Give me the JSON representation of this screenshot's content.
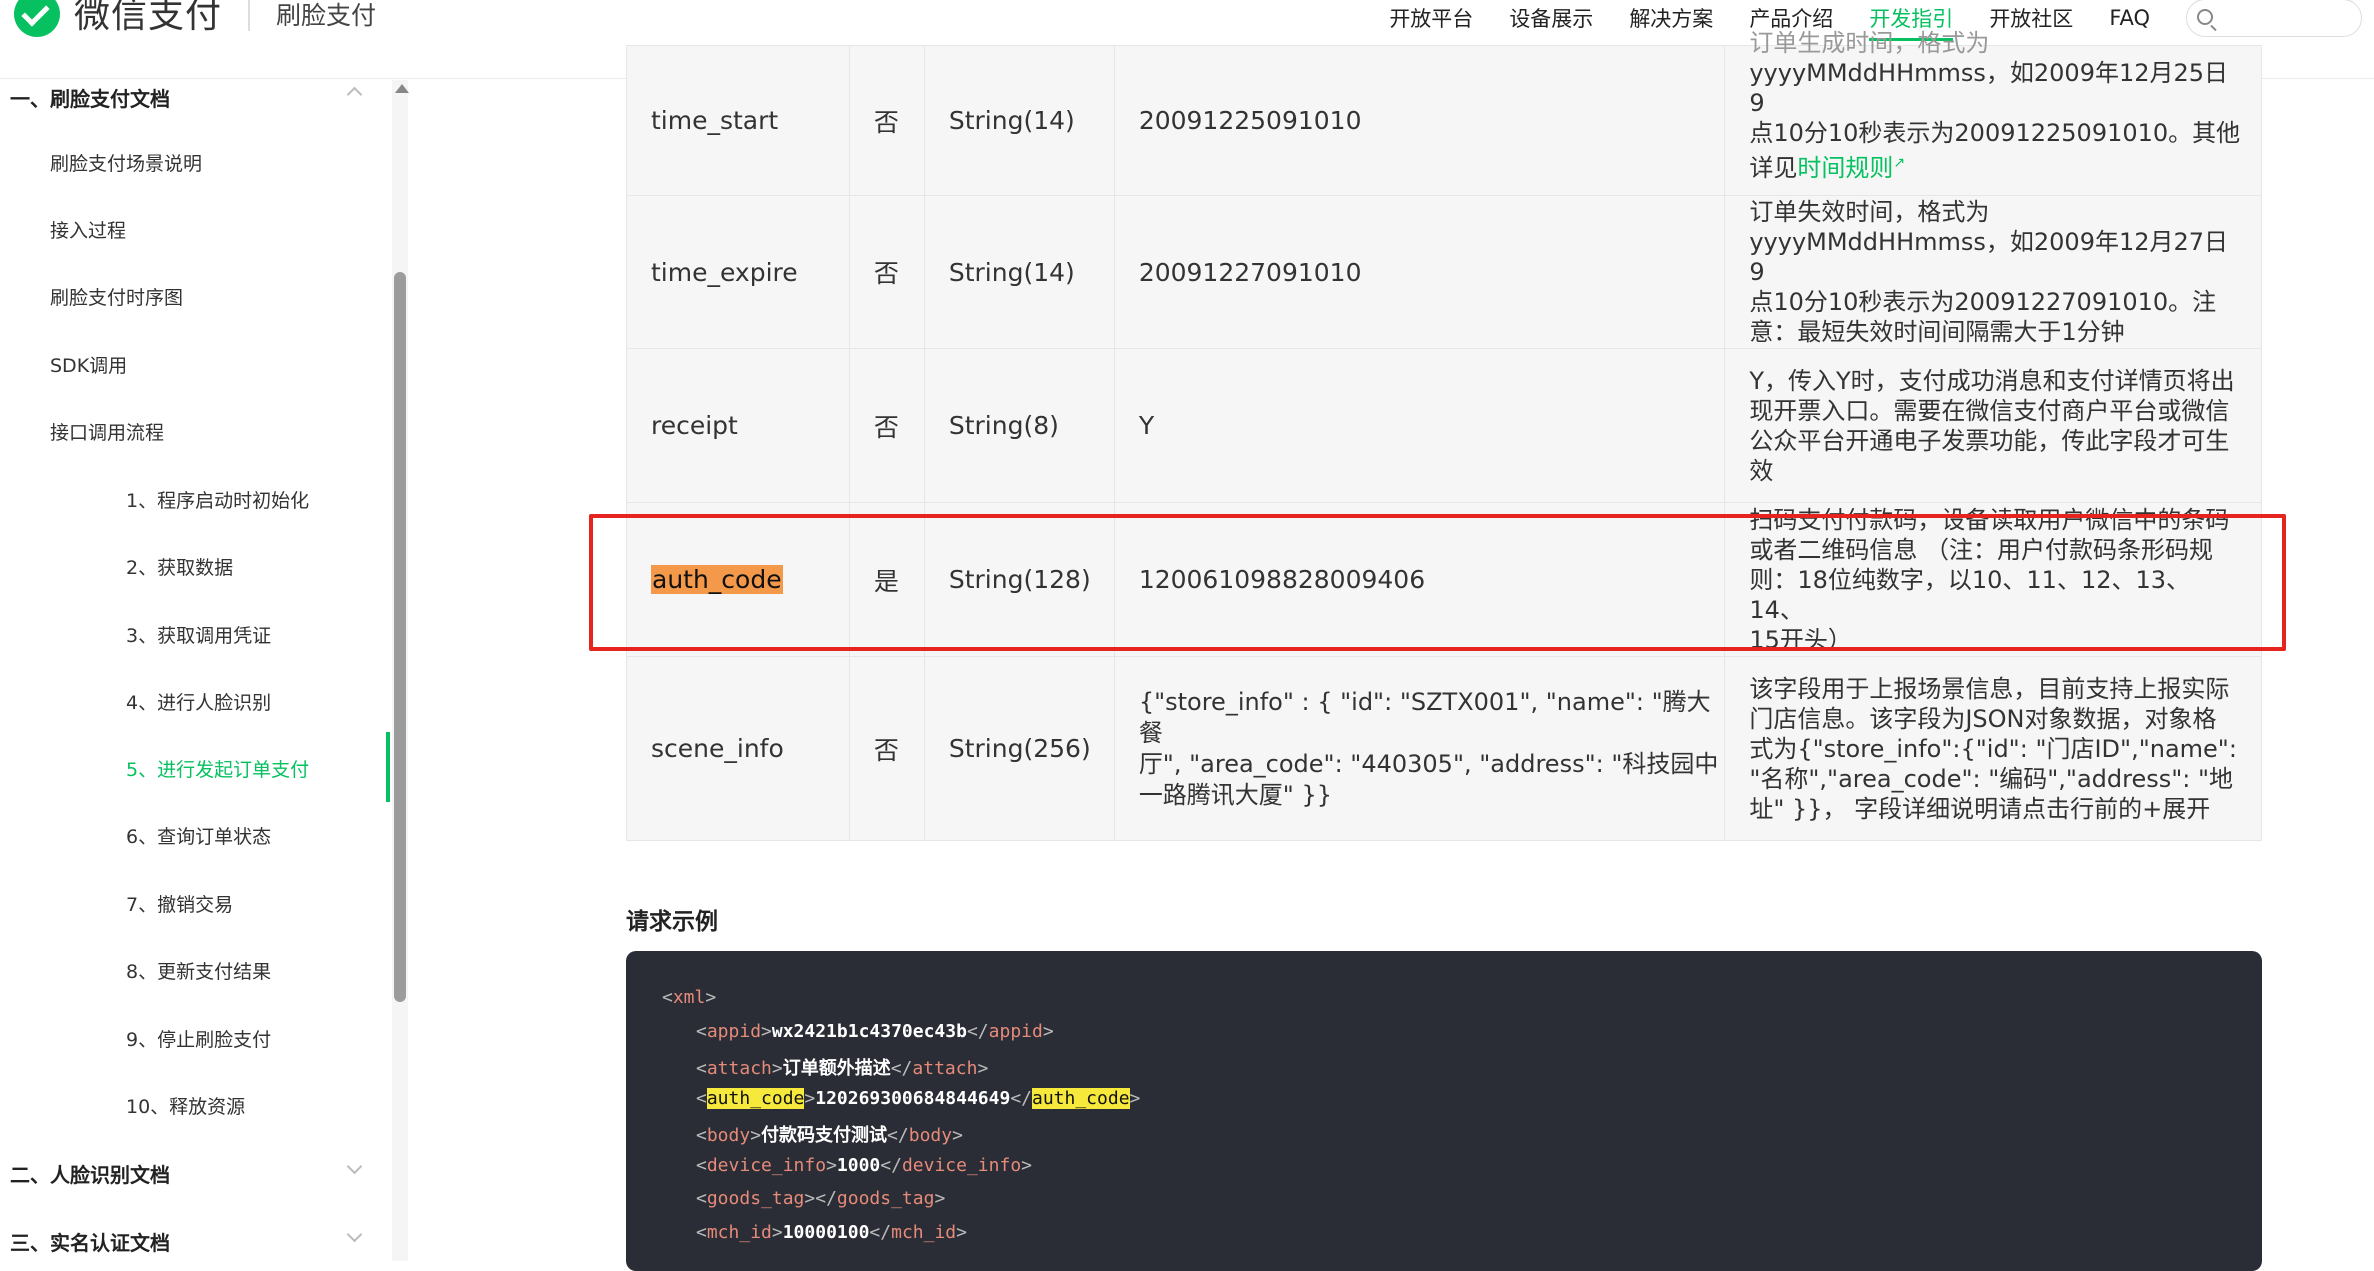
{
  "header": {
    "brand": "微信支付",
    "product": "刷脸支付",
    "nav": [
      "开放平台",
      "设备展示",
      "解决方案",
      "产品介绍",
      "开发指引",
      "开放社区",
      "FAQ"
    ],
    "active_nav": "开发指引",
    "search_placeholder": ""
  },
  "sidebar": {
    "section1": "一、刷脸支付文档",
    "items": [
      "刷脸支付场景说明",
      "接入过程",
      "刷脸支付时序图",
      "SDK调用",
      "接口调用流程"
    ],
    "subitems": [
      "1、程序启动时初始化",
      "2、获取数据",
      "3、获取调用凭证",
      "4、进行人脸识别",
      "5、进行发起订单支付",
      "6、查询订单状态",
      "7、撤销交易",
      "8、更新支付结果",
      "9、停止刷脸支付",
      "10、释放资源"
    ],
    "active_subitem": "5、进行发起订单支付",
    "section2": "二、人脸识别文档",
    "section3": "三、实名认证文档"
  },
  "table": {
    "rows": [
      {
        "name": "time_start",
        "required": "否",
        "type": "String(14)",
        "example": "20091225091010",
        "desc_lines": [
          "订单生成时间，格式为",
          "yyyyMMddHHmmss，如2009年12月25日9",
          "点10分10秒表示为20091225091010。其他",
          "详见"
        ],
        "desc_link": "时间规则"
      },
      {
        "name": "time_expire",
        "required": "否",
        "type": "String(14)",
        "example": "20091227091010",
        "desc_lines": [
          "订单失效时间，格式为",
          "yyyyMMddHHmmss，如2009年12月27日9",
          "点10分10秒表示为20091227091010。注",
          "意：最短失效时间间隔需大于1分钟"
        ]
      },
      {
        "name": "receipt",
        "required": "否",
        "type": "String(8)",
        "example": "Y",
        "desc_lines": [
          "Y，传入Y时，支付成功消息和支付详情页将出",
          "现开票入口。需要在微信支付商户平台或微信",
          "公众平台开通电子发票功能，传此字段才可生",
          "效"
        ]
      },
      {
        "name": "auth_code",
        "required": "是",
        "type": "String(128)",
        "example": "120061098828009406",
        "desc_lines": [
          "扫码支付付款码，设备读取用户微信中的条码",
          "或者二维码信息 （注：用户付款码条形码规",
          "则：18位纯数字，以10、11、12、13、14、",
          "15开头）"
        ]
      },
      {
        "name": "scene_info",
        "required": "否",
        "type": "String(256)",
        "example_lines": [
          "{\"store_info\" : { \"id\": \"SZTX001\", \"name\": \"腾大餐",
          "厅\", \"area_code\": \"440305\", \"address\": \"科技园中",
          "一路腾讯大厦\" }}"
        ],
        "desc_lines": [
          "该字段用于上报场景信息，目前支持上报实际",
          "门店信息。该字段为JSON对象数据，对象格",
          "式为{\"store_info\":{\"id\": \"门店ID\",\"name\":",
          "\"名称\",\"area_code\": \"编码\",\"address\": \"地",
          "址\" }}， 字段详细说明请点击行前的+展开"
        ]
      }
    ]
  },
  "request_example": {
    "title": "请求示例",
    "lines": [
      {
        "tag": "xml",
        "value": "",
        "open_only": true
      },
      {
        "tag": "appid",
        "value": "wx2421b1c4370ec43b"
      },
      {
        "tag": "attach",
        "value": "订单额外描述"
      },
      {
        "tag": "auth_code",
        "value": "120269300684844649",
        "highlight": true
      },
      {
        "tag": "body",
        "value": "付款码支付测试"
      },
      {
        "tag": "device_info",
        "value": "1000"
      },
      {
        "tag": "goods_tag",
        "value": ""
      },
      {
        "tag": "mch_id",
        "value": "10000100"
      }
    ]
  },
  "colors": {
    "brand_green": "#07c160",
    "highlight_orange": "#f4994a",
    "annotation_red": "#e5231f",
    "code_bg": "#2a2d35"
  }
}
